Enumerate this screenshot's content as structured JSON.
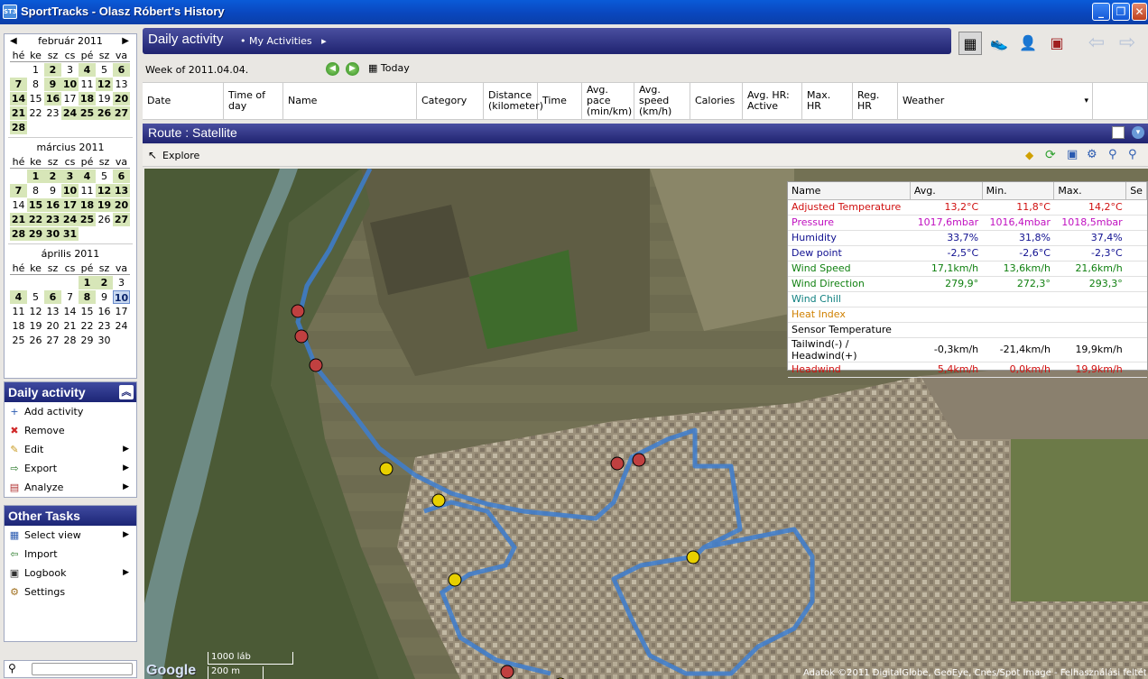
{
  "window": {
    "title": "SportTracks - Olasz Róbert's History",
    "app_icon": "ST3"
  },
  "calendars": [
    {
      "title": "február 2011",
      "day_headers": [
        "hé",
        "ke",
        "sz",
        "cs",
        "pé",
        "sz",
        "va"
      ],
      "days": [
        {
          "d": "",
          "s": ""
        },
        {
          "d": "1",
          "s": ""
        },
        {
          "d": "2",
          "s": "act"
        },
        {
          "d": "3",
          "s": ""
        },
        {
          "d": "4",
          "s": "act"
        },
        {
          "d": "5",
          "s": ""
        },
        {
          "d": "6",
          "s": "act"
        },
        {
          "d": "7",
          "s": "act"
        },
        {
          "d": "8",
          "s": ""
        },
        {
          "d": "9",
          "s": "act"
        },
        {
          "d": "10",
          "s": "act"
        },
        {
          "d": "11",
          "s": ""
        },
        {
          "d": "12",
          "s": "act"
        },
        {
          "d": "13",
          "s": ""
        },
        {
          "d": "14",
          "s": "act"
        },
        {
          "d": "15",
          "s": ""
        },
        {
          "d": "16",
          "s": "act"
        },
        {
          "d": "17",
          "s": ""
        },
        {
          "d": "18",
          "s": "act"
        },
        {
          "d": "19",
          "s": ""
        },
        {
          "d": "20",
          "s": "act"
        },
        {
          "d": "21",
          "s": "act"
        },
        {
          "d": "22",
          "s": ""
        },
        {
          "d": "23",
          "s": ""
        },
        {
          "d": "24",
          "s": "act"
        },
        {
          "d": "25",
          "s": "act"
        },
        {
          "d": "26",
          "s": "act"
        },
        {
          "d": "27",
          "s": "act"
        },
        {
          "d": "28",
          "s": "act"
        }
      ]
    },
    {
      "title": "március 2011",
      "day_headers": [
        "hé",
        "ke",
        "sz",
        "cs",
        "pé",
        "sz",
        "va"
      ],
      "days": [
        {
          "d": "",
          "s": ""
        },
        {
          "d": "1",
          "s": "act"
        },
        {
          "d": "2",
          "s": "act"
        },
        {
          "d": "3",
          "s": "act"
        },
        {
          "d": "4",
          "s": "act"
        },
        {
          "d": "5",
          "s": ""
        },
        {
          "d": "6",
          "s": "act"
        },
        {
          "d": "7",
          "s": "act"
        },
        {
          "d": "8",
          "s": ""
        },
        {
          "d": "9",
          "s": ""
        },
        {
          "d": "10",
          "s": "act"
        },
        {
          "d": "11",
          "s": ""
        },
        {
          "d": "12",
          "s": "act"
        },
        {
          "d": "13",
          "s": "act"
        },
        {
          "d": "14",
          "s": ""
        },
        {
          "d": "15",
          "s": "act"
        },
        {
          "d": "16",
          "s": "act"
        },
        {
          "d": "17",
          "s": "act"
        },
        {
          "d": "18",
          "s": "act"
        },
        {
          "d": "19",
          "s": "act"
        },
        {
          "d": "20",
          "s": "act"
        },
        {
          "d": "21",
          "s": "act"
        },
        {
          "d": "22",
          "s": "act"
        },
        {
          "d": "23",
          "s": "act"
        },
        {
          "d": "24",
          "s": "act"
        },
        {
          "d": "25",
          "s": "act"
        },
        {
          "d": "26",
          "s": ""
        },
        {
          "d": "27",
          "s": "act"
        },
        {
          "d": "28",
          "s": "act"
        },
        {
          "d": "29",
          "s": "act"
        },
        {
          "d": "30",
          "s": "act"
        },
        {
          "d": "31",
          "s": "act"
        }
      ]
    },
    {
      "title": "április 2011",
      "day_headers": [
        "hé",
        "ke",
        "sz",
        "cs",
        "pé",
        "sz",
        "va"
      ],
      "days": [
        {
          "d": "",
          "s": ""
        },
        {
          "d": "",
          "s": ""
        },
        {
          "d": "",
          "s": ""
        },
        {
          "d": "",
          "s": ""
        },
        {
          "d": "1",
          "s": "act"
        },
        {
          "d": "2",
          "s": "act"
        },
        {
          "d": "3",
          "s": ""
        },
        {
          "d": "4",
          "s": "act"
        },
        {
          "d": "5",
          "s": ""
        },
        {
          "d": "6",
          "s": "act"
        },
        {
          "d": "7",
          "s": ""
        },
        {
          "d": "8",
          "s": "act"
        },
        {
          "d": "9",
          "s": ""
        },
        {
          "d": "10",
          "s": "today"
        },
        {
          "d": "11",
          "s": ""
        },
        {
          "d": "12",
          "s": ""
        },
        {
          "d": "13",
          "s": ""
        },
        {
          "d": "14",
          "s": ""
        },
        {
          "d": "15",
          "s": ""
        },
        {
          "d": "16",
          "s": ""
        },
        {
          "d": "17",
          "s": ""
        },
        {
          "d": "18",
          "s": ""
        },
        {
          "d": "19",
          "s": ""
        },
        {
          "d": "20",
          "s": ""
        },
        {
          "d": "21",
          "s": ""
        },
        {
          "d": "22",
          "s": ""
        },
        {
          "d": "23",
          "s": ""
        },
        {
          "d": "24",
          "s": ""
        },
        {
          "d": "25",
          "s": ""
        },
        {
          "d": "26",
          "s": ""
        },
        {
          "d": "27",
          "s": ""
        },
        {
          "d": "28",
          "s": ""
        },
        {
          "d": "29",
          "s": ""
        },
        {
          "d": "30",
          "s": ""
        }
      ]
    }
  ],
  "daily_panel": {
    "title": "Daily activity",
    "items": [
      {
        "label": "Add activity",
        "icon": "+",
        "color": "#2a5ab0"
      },
      {
        "label": "Remove",
        "icon": "✖",
        "color": "#d02a2a"
      },
      {
        "label": "Edit",
        "icon": "✎",
        "color": "#c89a20",
        "arrow": "▶"
      },
      {
        "label": "Export",
        "icon": "⇨",
        "color": "#2a7a2a",
        "arrow": "▶"
      },
      {
        "label": "Analyze",
        "icon": "▤",
        "color": "#b03030",
        "arrow": "▶"
      }
    ]
  },
  "other_panel": {
    "title": "Other Tasks",
    "items": [
      {
        "label": "Select view",
        "icon": "▦",
        "color": "#2a5ab0",
        "arrow": "▶"
      },
      {
        "label": "Import",
        "icon": "⇦",
        "color": "#2a7a2a"
      },
      {
        "label": "Logbook",
        "icon": "▣",
        "color": "#333",
        "arrow": "▶"
      },
      {
        "label": "Settings",
        "icon": "⚙",
        "color": "#a07020"
      }
    ]
  },
  "header": {
    "title": "Daily activity",
    "breadcrumb": "• My Activities",
    "breadcrumb_arrow": "▸"
  },
  "week": {
    "label": "Week of 2011.04.04.",
    "today": "Today"
  },
  "columns": [
    "Date",
    "Time of day",
    "Name",
    "Category",
    "Distance\n(kilometer)",
    "Time",
    "Avg.\npace\n(min/km)",
    "Avg.\nspeed\n(km/h)",
    "Calories",
    "Avg. HR:\nActive",
    "Max. HR",
    "Reg.\nHR",
    "Weather"
  ],
  "route": {
    "title": "Route : Satellite",
    "explore": "Explore"
  },
  "weather_table": {
    "headers": [
      "Name",
      "Avg.",
      "Min.",
      "Max.",
      "Se"
    ],
    "rows": [
      {
        "name": "Adjusted Temperature",
        "avg": "13,2°C",
        "min": "11,8°C",
        "max": "14,2°C",
        "color": "#d01010"
      },
      {
        "name": "Pressure",
        "avg": "1017,6mbar",
        "min": "1016,4mbar",
        "max": "1018,5mbar",
        "color": "#c010c0"
      },
      {
        "name": "Humidity",
        "avg": "33,7%",
        "min": "31,8%",
        "max": "37,4%",
        "color": "#101090"
      },
      {
        "name": "Dew point",
        "avg": "-2,5°C",
        "min": "-2,6°C",
        "max": "-2,3°C",
        "color": "#101090"
      },
      {
        "name": "Wind Speed",
        "avg": "17,1km/h",
        "min": "13,6km/h",
        "max": "21,6km/h",
        "color": "#108010"
      },
      {
        "name": "Wind Direction",
        "avg": "279,9°",
        "min": "272,3°",
        "max": "293,3°",
        "color": "#108010"
      },
      {
        "name": "Wind Chill",
        "avg": "",
        "min": "",
        "max": "",
        "color": "#108080"
      },
      {
        "name": "Heat Index",
        "avg": "",
        "min": "",
        "max": "",
        "color": "#d08000"
      },
      {
        "name": "Sensor Temperature",
        "avg": "",
        "min": "",
        "max": "",
        "color": "#000000"
      },
      {
        "name": "Tailwind(-) / Headwind(+)",
        "avg": "-0,3km/h",
        "min": "-21,4km/h",
        "max": "19,9km/h",
        "color": "#000000"
      },
      {
        "name": "Headwind",
        "avg": "5,4km/h",
        "min": "0,0km/h",
        "max": "19,9km/h",
        "color": "#d01010"
      }
    ]
  },
  "map": {
    "scale_ft": "1000 láb",
    "scale_m": "200 m",
    "logo": "Google",
    "copyright": "Adatok ©2011 DigitalGlobe, GeoEye, Cnes/Spot Image - Felhasználási feltételek"
  }
}
